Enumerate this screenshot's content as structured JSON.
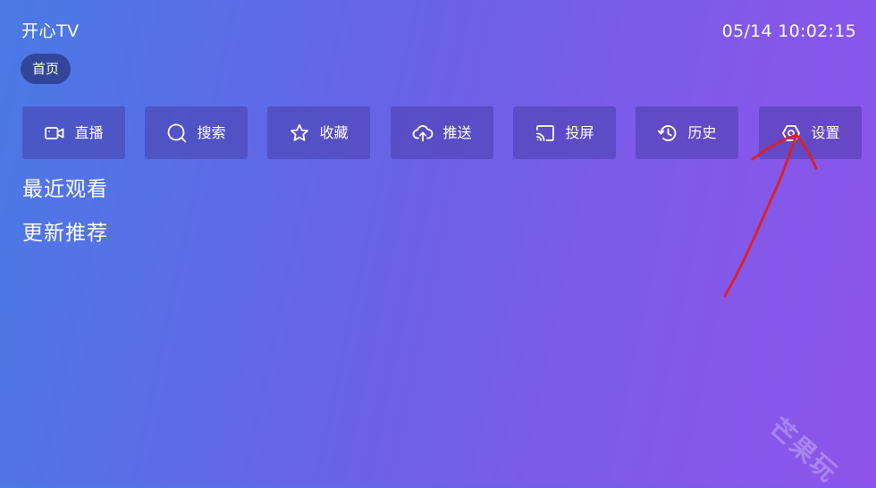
{
  "header": {
    "app_title": "开心TV",
    "clock": "05/14 10:02:15"
  },
  "nav": {
    "home_tab": "首页"
  },
  "menu": {
    "items": [
      {
        "label": "直播",
        "icon": "live-camera-icon"
      },
      {
        "label": "搜索",
        "icon": "search-icon"
      },
      {
        "label": "收藏",
        "icon": "star-icon"
      },
      {
        "label": "推送",
        "icon": "cloud-upload-icon"
      },
      {
        "label": "投屏",
        "icon": "cast-icon"
      },
      {
        "label": "历史",
        "icon": "history-icon"
      },
      {
        "label": "设置",
        "icon": "settings-icon"
      }
    ]
  },
  "sections": {
    "recent": "最近观看",
    "updates": "更新推荐"
  },
  "annotation": {
    "arrow_color": "#e02020",
    "target": "settings"
  },
  "watermark": "芒果玩",
  "colors": {
    "gradient_start": "#4a7ae6",
    "gradient_end": "#8e54ea",
    "button_bg": "#483eaa",
    "home_tab_bg": "#283682"
  }
}
